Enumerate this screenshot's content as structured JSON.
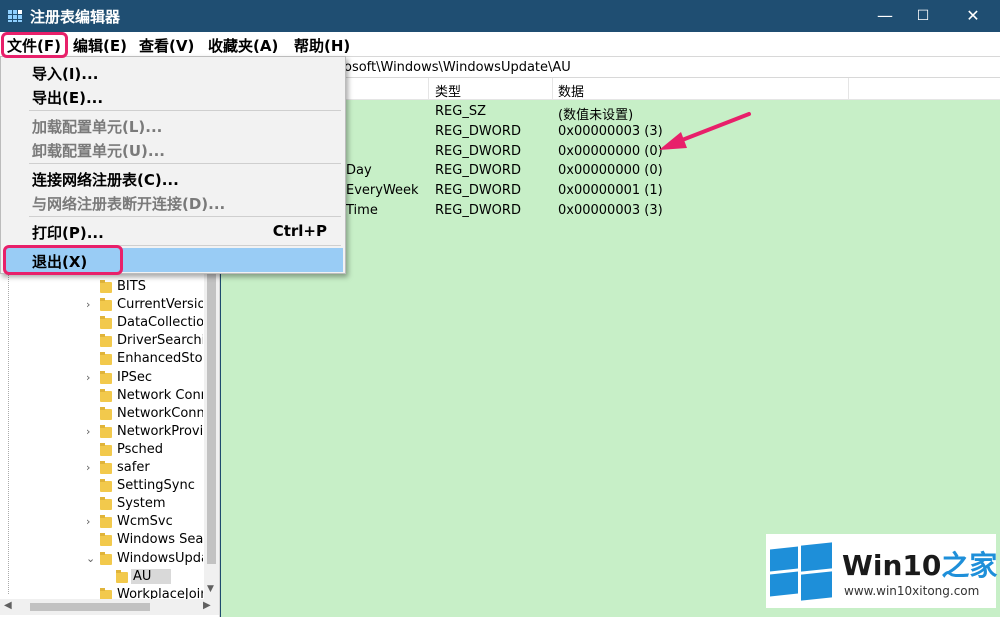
{
  "window": {
    "title": "注册表编辑器",
    "minimize": "—",
    "maximize": "☐",
    "close": "✕"
  },
  "menubar": {
    "file": "文件(F)",
    "edit": "编辑(E)",
    "view": "查看(V)",
    "favorites": "收藏夹(A)",
    "help": "帮助(H)"
  },
  "address": {
    "path": "osoft\\Windows\\WindowsUpdate\\AU"
  },
  "file_menu": {
    "import": "导入(I)...",
    "export": "导出(E)...",
    "load_hive": "加载配置单元(L)...",
    "unload_hive": "卸载配置单元(U)...",
    "connect": "连接网络注册表(C)...",
    "disconnect": "与网络注册表断开连接(D)...",
    "print": "打印(P)...",
    "print_shortcut": "Ctrl+P",
    "exit": "退出(X)"
  },
  "columns": {
    "type": "类型",
    "data": "数据"
  },
  "values": [
    {
      "name": "",
      "type": "REG_SZ",
      "data": "(数值未设置)"
    },
    {
      "name": "",
      "type": "REG_DWORD",
      "data": "0x00000003 (3)"
    },
    {
      "name": "",
      "type": "REG_DWORD",
      "data": "0x00000000 (0)"
    },
    {
      "name": "Day",
      "type": "REG_DWORD",
      "data": "0x00000000 (0)"
    },
    {
      "name": "EveryWeek",
      "type": "REG_DWORD",
      "data": "0x00000001 (1)"
    },
    {
      "name": "Time",
      "type": "REG_DWORD",
      "data": "0x00000003 (3)"
    }
  ],
  "tree": {
    "items": [
      "BITS",
      "CurrentVersion",
      "DataCollection",
      "DriverSearching",
      "EnhancedStorage",
      "IPSec",
      "Network Connections",
      "NetworkConnectivity",
      "NetworkProvider",
      "Psched",
      "safer",
      "SettingSync",
      "System",
      "WcmSvc",
      "Windows Search",
      "WindowsUpdate",
      "AU",
      "WorkplaceJoin"
    ]
  },
  "watermark": {
    "brand": "Win10",
    "brand_suffix": "之家",
    "url": "www.win10xitong.com"
  },
  "colors": {
    "accent": "#e8206a",
    "selection": "#99ccf5",
    "values_bg": "#c7efc7"
  }
}
